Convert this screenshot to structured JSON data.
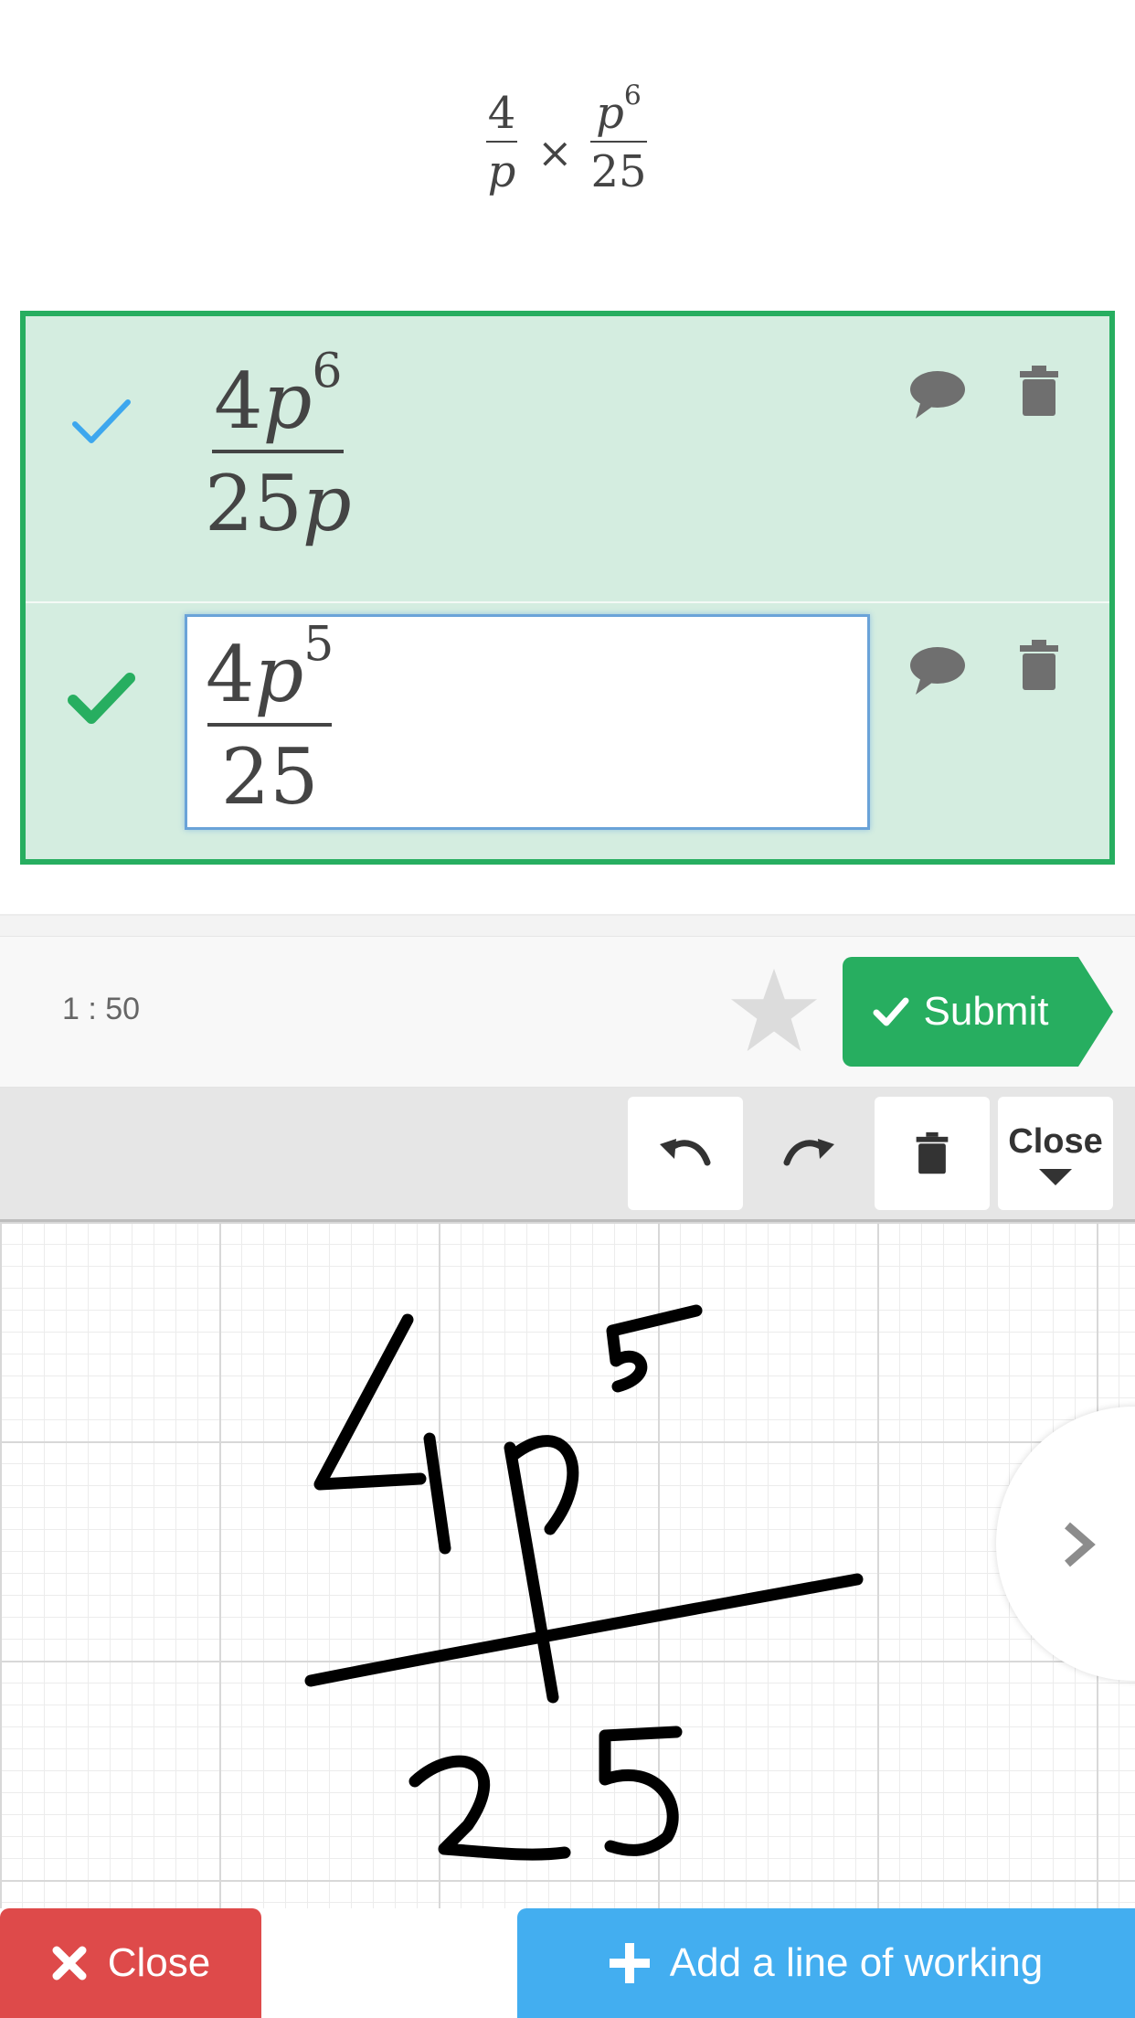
{
  "question": {
    "left_numerator": "4",
    "left_denominator": "p",
    "operator": "×",
    "right_numerator_base": "p",
    "right_numerator_exp": "6",
    "right_denominator": "25"
  },
  "working": {
    "lines": [
      {
        "status": "check-faded",
        "numerator_coef": "4",
        "numerator_var": "p",
        "numerator_exp": "6",
        "denominator_coef": "25",
        "denominator_var": "p",
        "icons": [
          "comment-icon",
          "trash-icon"
        ]
      },
      {
        "status": "check-correct",
        "numerator_coef": "4",
        "numerator_var": "p",
        "numerator_exp": "5",
        "denominator_coef": "25",
        "active": true,
        "icons": [
          "comment-icon",
          "trash-icon"
        ]
      }
    ]
  },
  "action_bar": {
    "timer": "1 : 50",
    "submit_label": "Submit"
  },
  "toolbar": {
    "close_label": "Close",
    "icons": [
      "undo-icon",
      "redo-icon",
      "trash-icon",
      "chevron-down-icon"
    ]
  },
  "canvas": {
    "next_icon": "chevron-right-icon"
  },
  "bottom": {
    "close_label": "Close",
    "add_line_label": "Add a line of working"
  },
  "colors": {
    "green": "#27ae60",
    "line_bg": "#d4ede0",
    "blue_check": "#3da7ee",
    "red": "#de4a4a",
    "blue": "#43aef0",
    "icon_gray": "#6f6f6f"
  }
}
